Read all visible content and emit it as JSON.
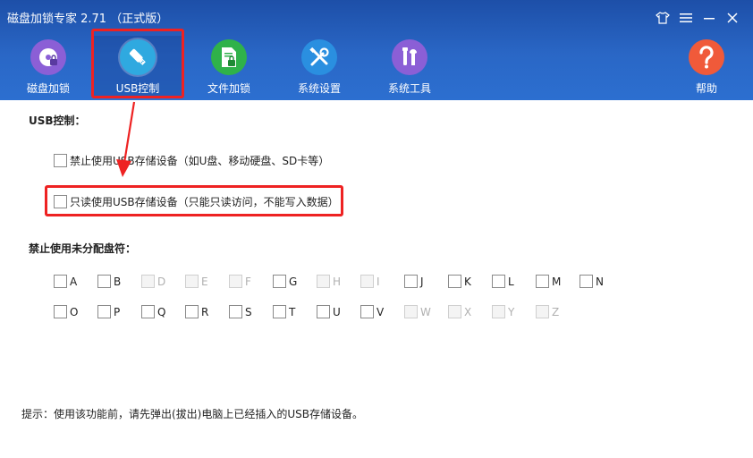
{
  "window": {
    "title": "磁盘加锁专家 2.71 （正式版）",
    "controls": [
      "skin-icon",
      "menu-icon",
      "minimize-icon",
      "close-icon"
    ]
  },
  "nav": {
    "items": [
      {
        "label": "磁盘加锁",
        "icon": "disk-lock-icon",
        "color": "#8b5fd6"
      },
      {
        "label": "USB控制",
        "icon": "usb-drive-icon",
        "color": "#2fa9e0",
        "active": true
      },
      {
        "label": "文件加锁",
        "icon": "file-lock-icon",
        "color": "#2fb24a"
      },
      {
        "label": "系统设置",
        "icon": "tools-icon",
        "color": "#2a8fe0"
      },
      {
        "label": "系统工具",
        "icon": "wrench-screwdriver-icon",
        "color": "#8b5fd6"
      },
      {
        "label": "帮助",
        "icon": "question-icon",
        "color": "#f05a3a"
      }
    ]
  },
  "usb": {
    "section_title": "USB控制：",
    "option1": "禁止使用USB存储设备（如U盘、移动硬盘、SD卡等）",
    "option2": "只读使用USB存储设备（只能只读访问，不能写入数据）"
  },
  "drives": {
    "section_title": "禁止使用未分配盘符：",
    "row1": [
      {
        "letter": "A",
        "disabled": false
      },
      {
        "letter": "B",
        "disabled": false
      },
      {
        "letter": "D",
        "disabled": true
      },
      {
        "letter": "E",
        "disabled": true
      },
      {
        "letter": "F",
        "disabled": true
      },
      {
        "letter": "G",
        "disabled": false
      },
      {
        "letter": "H",
        "disabled": true
      },
      {
        "letter": "I",
        "disabled": true
      },
      {
        "letter": "J",
        "disabled": false
      },
      {
        "letter": "K",
        "disabled": false
      },
      {
        "letter": "L",
        "disabled": false
      },
      {
        "letter": "M",
        "disabled": false
      },
      {
        "letter": "N",
        "disabled": false
      }
    ],
    "row2": [
      {
        "letter": "O",
        "disabled": false
      },
      {
        "letter": "P",
        "disabled": false
      },
      {
        "letter": "Q",
        "disabled": false
      },
      {
        "letter": "R",
        "disabled": false
      },
      {
        "letter": "S",
        "disabled": false
      },
      {
        "letter": "T",
        "disabled": false
      },
      {
        "letter": "U",
        "disabled": false
      },
      {
        "letter": "V",
        "disabled": false
      },
      {
        "letter": "W",
        "disabled": true
      },
      {
        "letter": "X",
        "disabled": true
      },
      {
        "letter": "Y",
        "disabled": true
      },
      {
        "letter": "Z",
        "disabled": true
      }
    ]
  },
  "tip": "提示：使用该功能前，请先弹出(拔出)电脑上已经插入的USB存储设备。",
  "colors": {
    "header": "#2a67c6",
    "highlight": "#ee2222"
  }
}
